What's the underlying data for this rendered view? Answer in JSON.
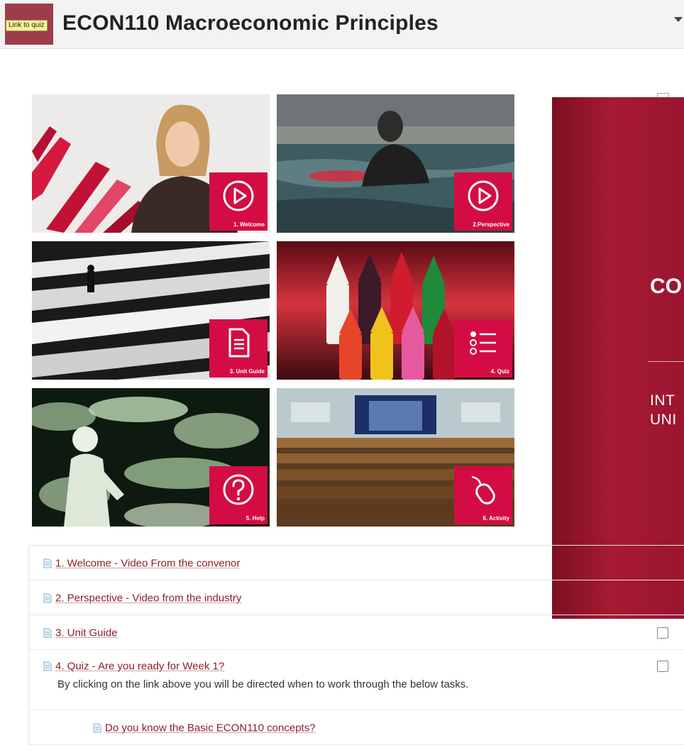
{
  "header": {
    "tooltip": "Link to quiz",
    "course_title": "ECON110 Macroeconomic Principles"
  },
  "tiles": [
    {
      "label": "1. Welcome",
      "icon": "play-icon"
    },
    {
      "label": "2.Perspective",
      "icon": "play-icon"
    },
    {
      "label": "3. Unit Guide",
      "icon": "document-icon"
    },
    {
      "label": "4. Quiz",
      "icon": "list-icon"
    },
    {
      "label": "5. Help",
      "icon": "question-icon"
    },
    {
      "label": "6. Activity",
      "icon": "mouse-icon"
    }
  ],
  "overlay": {
    "big_text": "CO",
    "sub_line1": "INT",
    "sub_line2": "UNI"
  },
  "activities": [
    {
      "label": "1. Welcome - Video From the convenor"
    },
    {
      "label": "2. Perspective - Video from the industry"
    },
    {
      "label": "3. Unit Guide"
    },
    {
      "label": "4. Quiz - Are you ready for Week 1?"
    },
    {
      "label": "Do you know the Basic ECON110 concepts?"
    }
  ],
  "quiz_description": "By clicking on the link above you will be directed when to work through the below tasks.",
  "colors": {
    "badge": "#d30d43",
    "overlay": "#a61a33",
    "link": "#8c1d2b"
  }
}
